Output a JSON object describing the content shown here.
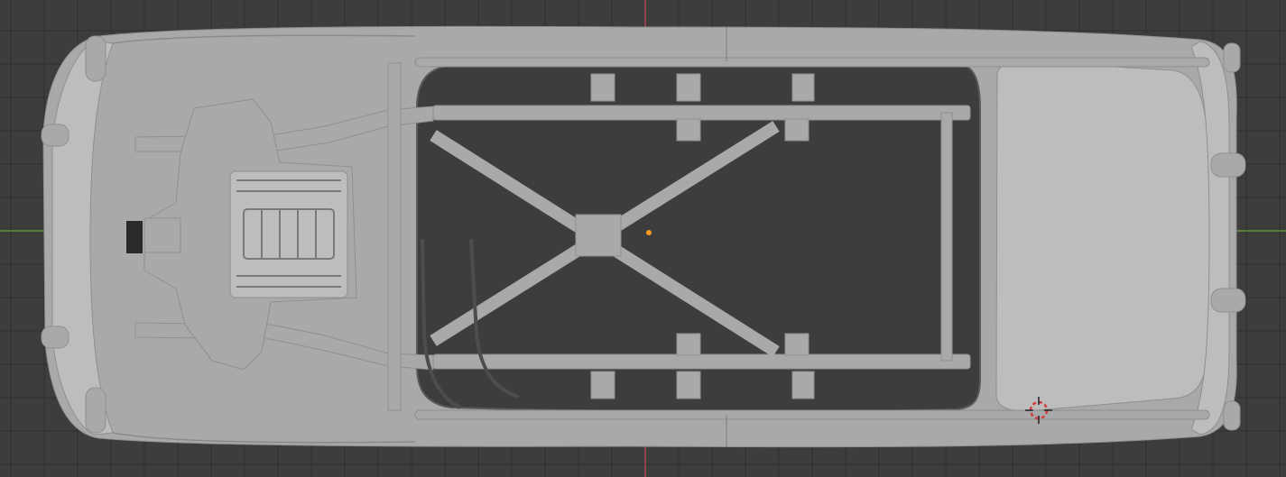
{
  "viewport": {
    "background": "#3d3d3d",
    "grid_minor_color": "#343434",
    "grid_major_color": "#2e2e2e",
    "x_axis_color": "#6fa43a",
    "y_axis_color": "#c9475a",
    "origin_color": "#ff9a1f"
  },
  "scene": {
    "object": "car-chassis-top-view",
    "body_color": "#a9a9a9",
    "body_shade": "#8f8f8f",
    "body_dark": "#5a5a5a",
    "body_light": "#bdbdbd"
  },
  "cursor_3d": {
    "ring_red": "#d23c3c",
    "ring_white": "#ffffff"
  }
}
